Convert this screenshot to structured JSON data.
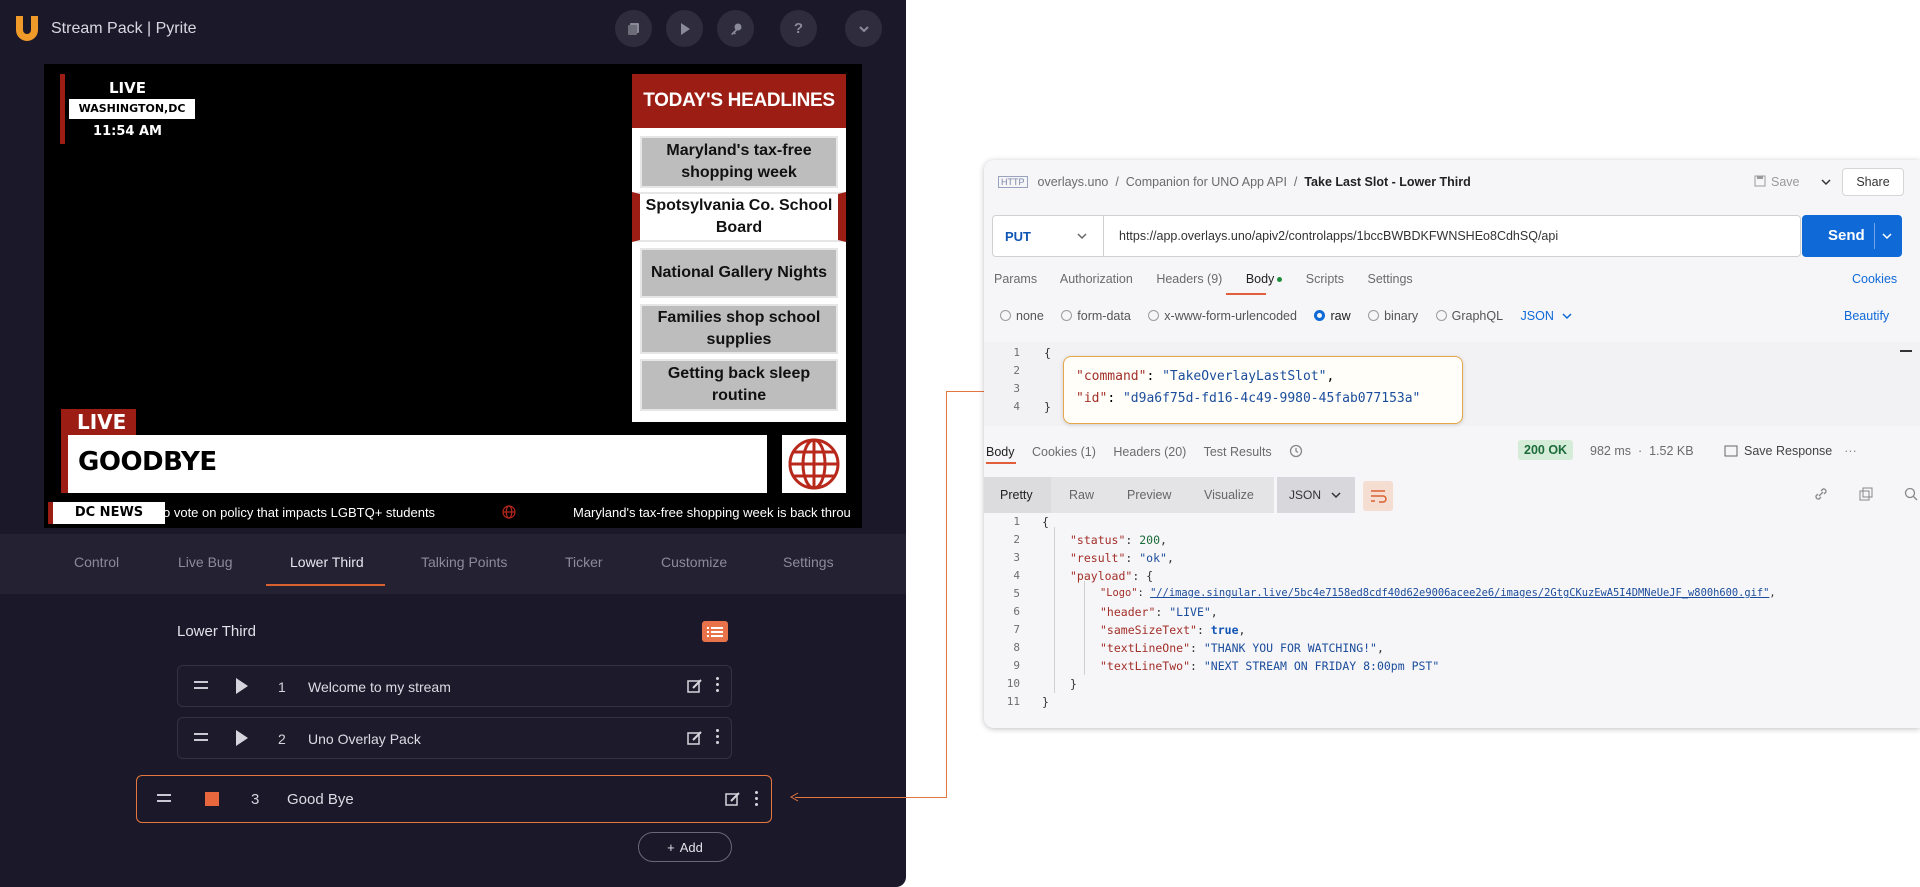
{
  "app": {
    "title": "Stream Pack | Pyrite",
    "header_buttons": [
      "copy-icon",
      "play-icon",
      "key-icon",
      "help-icon",
      "chevron-down-icon"
    ],
    "help_glyph": "?",
    "chevron_glyph": "⌄"
  },
  "preview": {
    "bug": {
      "live": "LIVE",
      "location": "WASHINGTON,DC",
      "time": "11:54 AM"
    },
    "headlines": {
      "title": "TODAY'S HEADLINES",
      "items": [
        "Maryland's tax-free shopping week",
        "Spotsylvania Co. School Board",
        "National Gallery Nights",
        "Families shop school supplies",
        "Getting back sleep routine"
      ],
      "active_index": 1
    },
    "lower_third": {
      "tag": "LIVE",
      "text": "GOODBYE"
    },
    "ticker": {
      "label": "DC NEWS",
      "text1": "o vote on policy that impacts LGBTQ+ students",
      "text2": "Maryland's tax-free shopping week is back throu"
    }
  },
  "tabs": [
    {
      "label": "Control"
    },
    {
      "label": "Live Bug"
    },
    {
      "label": "Lower Third",
      "active": true
    },
    {
      "label": "Talking Points"
    },
    {
      "label": "Ticker"
    },
    {
      "label": "Customize"
    },
    {
      "label": "Settings"
    }
  ],
  "panel": {
    "title": "Lower Third",
    "rows": [
      {
        "num": "1",
        "label": "Welcome to my stream"
      },
      {
        "num": "2",
        "label": "Uno Overlay Pack"
      },
      {
        "num": "3",
        "label": "Good Bye",
        "selected": true
      }
    ],
    "add_label": "Add",
    "add_glyph": "+"
  },
  "postman": {
    "http_badge": "HTTP",
    "breadcrumb": [
      "overlays.uno",
      "Companion for UNO App API",
      "Take Last Slot - Lower Third"
    ],
    "save_label": "Save",
    "share_label": "Share",
    "method": "PUT",
    "url": "https://app.overlays.uno/apiv2/controlapps/1bccBWBDKFWNSHEo8CdhSQ/api",
    "send_label": "Send",
    "request_tabs": [
      "Params",
      "Authorization",
      "Headers (9)",
      "Body",
      "Scripts",
      "Settings"
    ],
    "active_request_tab": "Body",
    "cookies_label": "Cookies",
    "body_types": [
      "none",
      "form-data",
      "x-www-form-urlencoded",
      "raw",
      "binary",
      "GraphQL"
    ],
    "selected_body_type": "raw",
    "format": "JSON",
    "beautify_label": "Beautify",
    "request_body": {
      "command_key": "\"command\"",
      "command_val": "\"TakeOverlayLastSlot\"",
      "id_key": "\"id\"",
      "id_val": "\"d9a6f75d-fd16-4c49-9980-45fab077153a\""
    },
    "response_tabs": [
      "Body",
      "Cookies (1)",
      "Headers (20)",
      "Test Results"
    ],
    "status": "200 OK",
    "time": "982 ms",
    "size": "1.52 KB",
    "save_response_label": "Save Response",
    "view_tabs": [
      "Pretty",
      "Raw",
      "Preview",
      "Visualize"
    ],
    "view_format": "JSON",
    "response_body": {
      "status_key": "\"status\"",
      "status_val": "200",
      "result_key": "\"result\"",
      "result_val": "\"ok\"",
      "payload_key": "\"payload\"",
      "logo_key": "\"Logo\"",
      "logo_val": "\"//image.singular.live/5bc4e7158ed8cdf40d62e9006acee2e6/images/2GtgCKuzEwA5I4DMNeUeJF_w800h600.gif\"",
      "header_key": "\"header\"",
      "header_val": "\"LIVE\"",
      "same_key": "\"sameSizeText\"",
      "same_val": "true",
      "line1_key": "\"textLineOne\"",
      "line1_val": "\"THANK YOU FOR WATCHING!\"",
      "line2_key": "\"textLineTwo\"",
      "line2_val": "\"NEXT STREAM ON FRIDAY 8:00pm PST\""
    }
  },
  "colors": {
    "app_bg": "#1b1929",
    "accent": "#e6763f",
    "news_red": "#9c1d14",
    "postman_blue": "#0f6ad8"
  }
}
